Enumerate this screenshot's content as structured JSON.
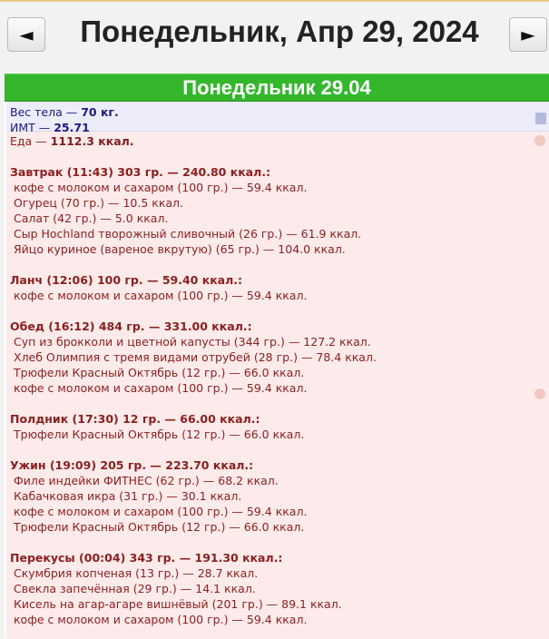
{
  "header": {
    "date_title": "Понедельник, Апр 29, 2024",
    "prev_label": "◄",
    "next_label": "►"
  },
  "day_bar": "Понедельник 29.04",
  "body": {
    "weight_label": "Вес тела —",
    "weight_value": "70 кг.",
    "bmi_label": "ИМТ —",
    "bmi_value": "25.71"
  },
  "food": {
    "total_label": "Еда —",
    "total_value": "1112.3 ккал.",
    "meals": [
      {
        "title": "Завтрак (11:43) 303 гр. — 240.80 ккал.:",
        "items": [
          "кофе с молоком и сахаром (100 гр.) — 59.4 ккал.",
          "Огурец (70 гр.) — 10.5 ккал.",
          "Салат (42 гр.) — 5.0 ккал.",
          "Сыр Hochland творожный сливочный (26 гр.) — 61.9 ккал.",
          "Яйцо куриное (вареное вкрутую) (65 гр.) — 104.0 ккал."
        ]
      },
      {
        "title": "Ланч (12:06) 100 гр. — 59.40 ккал.:",
        "items": [
          "кофе с молоком и сахаром (100 гр.) — 59.4 ккал."
        ]
      },
      {
        "title": "Обед (16:12) 484 гр. — 331.00 ккал.:",
        "items": [
          "Суп из брокколи и цветной капусты (344 гр.) — 127.2 ккал.",
          "Хлеб Олимпия с тремя видами отрубей (28 гр.) — 78.4 ккал.",
          "Трюфели Красный Октябрь (12 гр.) — 66.0 ккал.",
          "кофе с молоком и сахаром (100 гр.) — 59.4 ккал."
        ]
      },
      {
        "title": "Полдник (17:30) 12 гр. — 66.00 ккал.:",
        "items": [
          "Трюфели Красный Октябрь (12 гр.) — 66.0 ккал."
        ]
      },
      {
        "title": "Ужин (19:09) 205 гр. — 223.70 ккал.:",
        "items": [
          "Филе индейки ФИТНЕС (62 гр.) — 68.2 ккал.",
          "Кабачковая икра (31 гр.) — 30.1 ккал.",
          "кофе с молоком и сахаром (100 гр.) — 59.4 ккал.",
          "Трюфели Красный Октябрь (12 гр.) — 66.0 ккал."
        ]
      },
      {
        "title": "Перекусы (00:04) 343 гр. — 191.30 ккал.:",
        "items": [
          "Скумбрия копченая (13 гр.) — 28.7 ккал.",
          "Свекла запечённая (29 гр.) — 14.1 ккал.",
          "Кисель на агар-агаре вишнёвый (201 гр.) — 89.1 ккал.",
          "кофе с молоком и сахаром (100 гр.) — 59.4 ккал."
        ]
      }
    ]
  }
}
